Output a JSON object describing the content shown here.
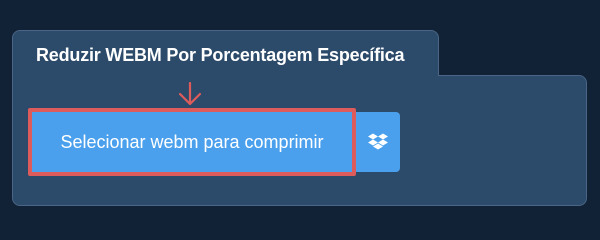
{
  "tab": {
    "title": "Reduzir WEBM Por Porcentagem Específica"
  },
  "upload": {
    "button_label": "Selecionar webm para comprimir",
    "dropbox_icon": "dropbox-icon"
  },
  "colors": {
    "background": "#112236",
    "panel": "#2c4a6a",
    "button": "#4aa0ec",
    "highlight": "#de5b5b"
  }
}
